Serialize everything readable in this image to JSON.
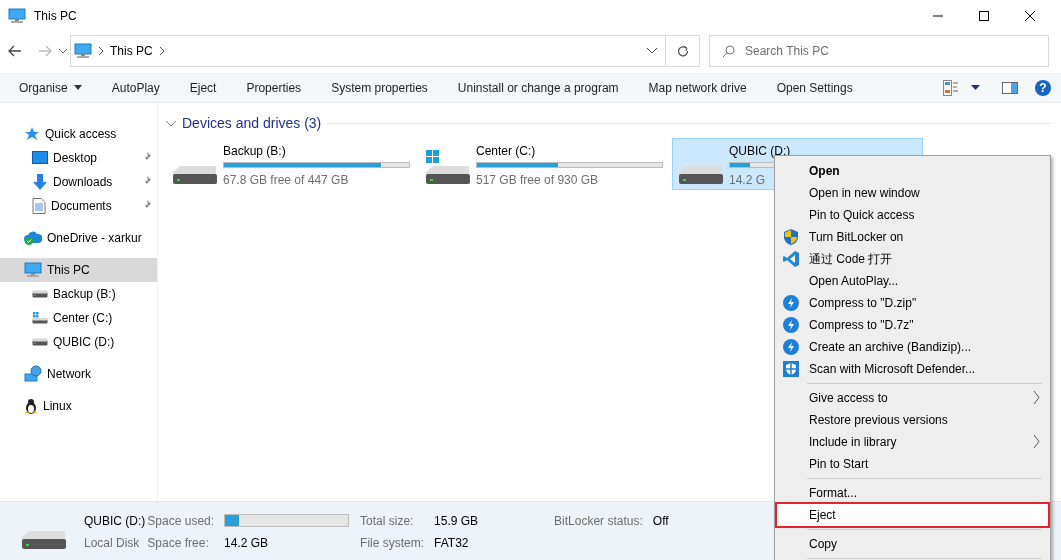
{
  "window": {
    "title": "This PC"
  },
  "address": {
    "path": [
      "This PC"
    ]
  },
  "search": {
    "placeholder": "Search This PC"
  },
  "toolbar": [
    {
      "label": "Organise",
      "dropdown": true
    },
    {
      "label": "AutoPlay",
      "dropdown": false
    },
    {
      "label": "Eject",
      "dropdown": false
    },
    {
      "label": "Properties",
      "dropdown": false
    },
    {
      "label": "System properties",
      "dropdown": false
    },
    {
      "label": "Uninstall or change a program",
      "dropdown": false
    },
    {
      "label": "Map network drive",
      "dropdown": false
    },
    {
      "label": "Open Settings",
      "dropdown": false
    }
  ],
  "help": {
    "label": "?"
  },
  "sidebar": [
    {
      "label": "Quick access",
      "selected": false,
      "children": [
        {
          "label": "Desktop",
          "pinned": true,
          "selected": false
        },
        {
          "label": "Downloads",
          "pinned": true,
          "selected": false
        },
        {
          "label": "Documents",
          "pinned": true,
          "selected": false
        }
      ]
    },
    {
      "label": "OneDrive - xarkur",
      "selected": false
    },
    {
      "label": "This PC",
      "selected": true,
      "children": [
        {
          "label": "Backup (B:)",
          "pinned": false,
          "selected": false
        },
        {
          "label": "Center (C:)",
          "pinned": false,
          "selected": false
        },
        {
          "label": "QUBIC (D:)",
          "pinned": false,
          "selected": false
        }
      ]
    },
    {
      "label": "Network",
      "selected": false
    },
    {
      "label": "Linux",
      "selected": false
    }
  ],
  "section": {
    "title": "Devices and drives (3)",
    "expanded": true
  },
  "drives": [
    {
      "name": "Backup (B:)",
      "free": "67.8 GB free of 447 GB",
      "level": 0.85,
      "selected": false
    },
    {
      "name": "Center (C:)",
      "free": "517 GB free of 930 GB",
      "level": 0.44,
      "selected": false
    },
    {
      "name": "QUBIC (D:)",
      "free": "14.2 G",
      "level": 0.11,
      "selected": true
    }
  ],
  "context_menu": [
    {
      "kind": "item",
      "label": "Open",
      "default": true,
      "submenu": false,
      "highlighted": false,
      "outlined": false
    },
    {
      "kind": "item",
      "label": "Open in new window",
      "default": false,
      "submenu": false,
      "highlighted": false,
      "outlined": false
    },
    {
      "kind": "item",
      "label": "Pin to Quick access",
      "default": false,
      "submenu": false,
      "highlighted": false,
      "outlined": false
    },
    {
      "kind": "item",
      "label": "Turn BitLocker on",
      "default": false,
      "submenu": false,
      "highlighted": false,
      "outlined": false
    },
    {
      "kind": "item",
      "label": "通过 Code 打开",
      "default": false,
      "submenu": false,
      "highlighted": false,
      "outlined": false
    },
    {
      "kind": "item",
      "label": "Open AutoPlay...",
      "default": false,
      "submenu": false,
      "highlighted": false,
      "outlined": false
    },
    {
      "kind": "item",
      "label": "Compress to \"D.zip\"",
      "default": false,
      "submenu": false,
      "highlighted": false,
      "outlined": false
    },
    {
      "kind": "item",
      "label": "Compress to \"D.7z\"",
      "default": false,
      "submenu": false,
      "highlighted": false,
      "outlined": false
    },
    {
      "kind": "item",
      "label": "Create an archive (Bandizip)...",
      "default": false,
      "submenu": false,
      "highlighted": false,
      "outlined": false
    },
    {
      "kind": "item",
      "label": "Scan with Microsoft Defender...",
      "default": false,
      "submenu": false,
      "highlighted": false,
      "outlined": false
    },
    {
      "kind": "separator"
    },
    {
      "kind": "item",
      "label": "Give access to",
      "default": false,
      "submenu": true,
      "highlighted": false,
      "outlined": false
    },
    {
      "kind": "item",
      "label": "Restore previous versions",
      "default": false,
      "submenu": false,
      "highlighted": false,
      "outlined": false
    },
    {
      "kind": "item",
      "label": "Include in library",
      "default": false,
      "submenu": true,
      "highlighted": false,
      "outlined": false
    },
    {
      "kind": "item",
      "label": "Pin to Start",
      "default": false,
      "submenu": false,
      "highlighted": false,
      "outlined": false
    },
    {
      "kind": "separator"
    },
    {
      "kind": "item",
      "label": "Format...",
      "default": false,
      "submenu": false,
      "highlighted": false,
      "outlined": false
    },
    {
      "kind": "item",
      "label": "Eject",
      "default": false,
      "submenu": false,
      "highlighted": true,
      "outlined": true
    },
    {
      "kind": "separator"
    },
    {
      "kind": "item",
      "label": "Copy",
      "default": false,
      "submenu": false,
      "highlighted": false,
      "outlined": false
    },
    {
      "kind": "separator"
    }
  ],
  "details": {
    "name": "QUBIC (D:)",
    "type": "Local Disk",
    "fields": [
      {
        "label": "Space used:",
        "kind": "meter",
        "level": 0.11
      },
      {
        "label": "Space free:",
        "kind": "text",
        "value": "14.2 GB"
      },
      {
        "label": "Total size:",
        "kind": "text",
        "value": "15.9 GB"
      },
      {
        "label": "File system:",
        "kind": "text",
        "value": "FAT32"
      },
      {
        "label": "BitLocker status:",
        "kind": "text",
        "value": "Off"
      }
    ]
  }
}
